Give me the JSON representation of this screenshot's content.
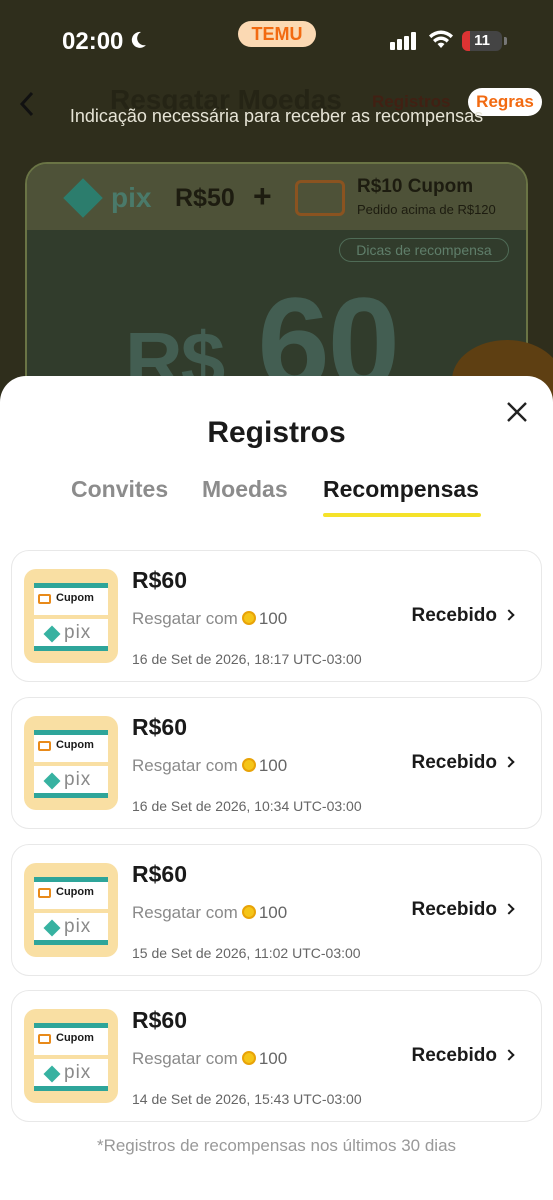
{
  "status_bar": {
    "time": "02:00",
    "app_pill": "TEMU",
    "battery": "11"
  },
  "background": {
    "title": "Resgatar Moedas",
    "registros_link": "Registros",
    "regras_label": "Regras",
    "subtitle": "Indicação necessária para receber as recompensas",
    "promo": {
      "pix_label": "pix",
      "amount": "R$50",
      "plus": "+",
      "coupon_title": "R$10 Cupom",
      "coupon_sub": "Pedido acima de R$120",
      "dicas": "Dicas de recompensa",
      "big_currency": "R$",
      "big_value": "60"
    }
  },
  "sheet": {
    "title": "Registros",
    "tabs": [
      {
        "label": "Convites",
        "active": false
      },
      {
        "label": "Moedas",
        "active": false
      },
      {
        "label": "Recompensas",
        "active": true
      }
    ],
    "records": [
      {
        "amount": "R$60",
        "redeem_text": "Resgatar com",
        "coins": "100",
        "status": "Recebido",
        "date": "16 de Set de 2026, 18:17 UTC-03:00",
        "thumb_cupom": "Cupom",
        "thumb_pix": "pix"
      },
      {
        "amount": "R$60",
        "redeem_text": "Resgatar com",
        "coins": "100",
        "status": "Recebido",
        "date": "16 de Set de 2026, 10:34 UTC-03:00",
        "thumb_cupom": "Cupom",
        "thumb_pix": "pix"
      },
      {
        "amount": "R$60",
        "redeem_text": "Resgatar com",
        "coins": "100",
        "status": "Recebido",
        "date": "15 de Set de 2026, 11:02 UTC-03:00",
        "thumb_cupom": "Cupom",
        "thumb_pix": "pix"
      },
      {
        "amount": "R$60",
        "redeem_text": "Resgatar com",
        "coins": "100",
        "status": "Recebido",
        "date": "14 de Set de 2026, 15:43 UTC-03:00",
        "thumb_cupom": "Cupom",
        "thumb_pix": "pix"
      }
    ],
    "footnote": "*Registros de recompensas nos últimos 30 dias"
  },
  "colors": {
    "accent_orange": "#f26a11",
    "tab_underline": "#f5e22a",
    "pix_teal": "#2ea59a",
    "thumb_bg": "#f9dfa3",
    "coin_gold": "#f5c518"
  },
  "icons": [
    "moon-icon",
    "signal-icon",
    "wifi-icon",
    "battery-icon",
    "back-arrow-icon",
    "close-icon",
    "coupon-icon",
    "pix-icon",
    "coin-icon",
    "chevron-right-icon"
  ]
}
